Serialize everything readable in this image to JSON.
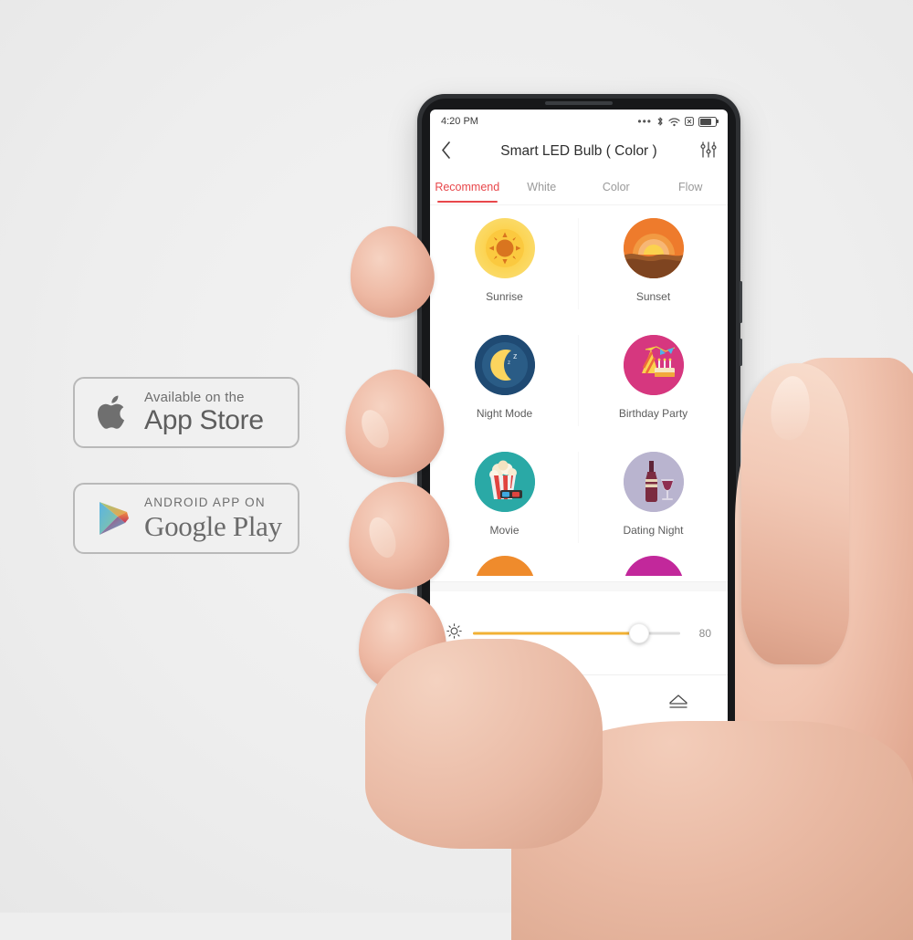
{
  "scene": {
    "background_color": "#eeeeee",
    "description": "Hand holding smartphone showing smart LED bulb app, with app store badges"
  },
  "badges": [
    {
      "name": "app-store",
      "top_line": "Available on the",
      "main_line": "App Store",
      "logo": "apple-icon"
    },
    {
      "name": "google-play",
      "top_line": "ANDROID APP ON",
      "main_line": "Google Play",
      "logo": "google-play-icon"
    }
  ],
  "phone": {
    "status_bar": {
      "time": "4:20 PM",
      "icons": [
        "ellipsis-icon",
        "bluetooth-icon",
        "wifi-icon",
        "silent-mode-icon",
        "battery-icon"
      ]
    },
    "appbar": {
      "back_icon": "chevron-left-icon",
      "title": "Smart LED Bulb ( Color )",
      "settings_icon": "sliders-icon"
    },
    "tabs": [
      {
        "label": "Recommend",
        "active": true
      },
      {
        "label": "White",
        "active": false
      },
      {
        "label": "Color",
        "active": false
      },
      {
        "label": "Flow",
        "active": false
      }
    ],
    "active_tab_color": "#e8474b",
    "scenes": [
      {
        "label": "Sunrise",
        "icon": "sunrise-icon",
        "color": "#fcd24e"
      },
      {
        "label": "Sunset",
        "icon": "sunset-icon",
        "color": "#ef7f2e"
      },
      {
        "label": "Night Mode",
        "icon": "moon-icon",
        "color": "#1f4a73"
      },
      {
        "label": "Birthday Party",
        "icon": "party-icon",
        "color": "#d6377f"
      },
      {
        "label": "Movie",
        "icon": "popcorn-icon",
        "color": "#2aa9a6"
      },
      {
        "label": "Dating Night",
        "icon": "wine-icon",
        "color": "#b9b4cf"
      }
    ],
    "partial_scenes": [
      {
        "label": "",
        "icon": "scene-icon",
        "color": "#ef8b2c"
      },
      {
        "label": "",
        "icon": "scene-icon",
        "color": "#c2289b"
      }
    ],
    "brightness": {
      "icon": "brightness-icon",
      "value": "80",
      "percent": 80,
      "fill_color": "#f2b134"
    },
    "bottom_bar": [
      {
        "name": "power-button",
        "icon": "power-icon",
        "color": "#e8474b"
      },
      {
        "name": "favorite-button",
        "icon": "star-plus-icon",
        "color": "#4a4a4a"
      },
      {
        "name": "eject-button",
        "icon": "eject-icon",
        "color": "#4a4a4a"
      }
    ]
  }
}
